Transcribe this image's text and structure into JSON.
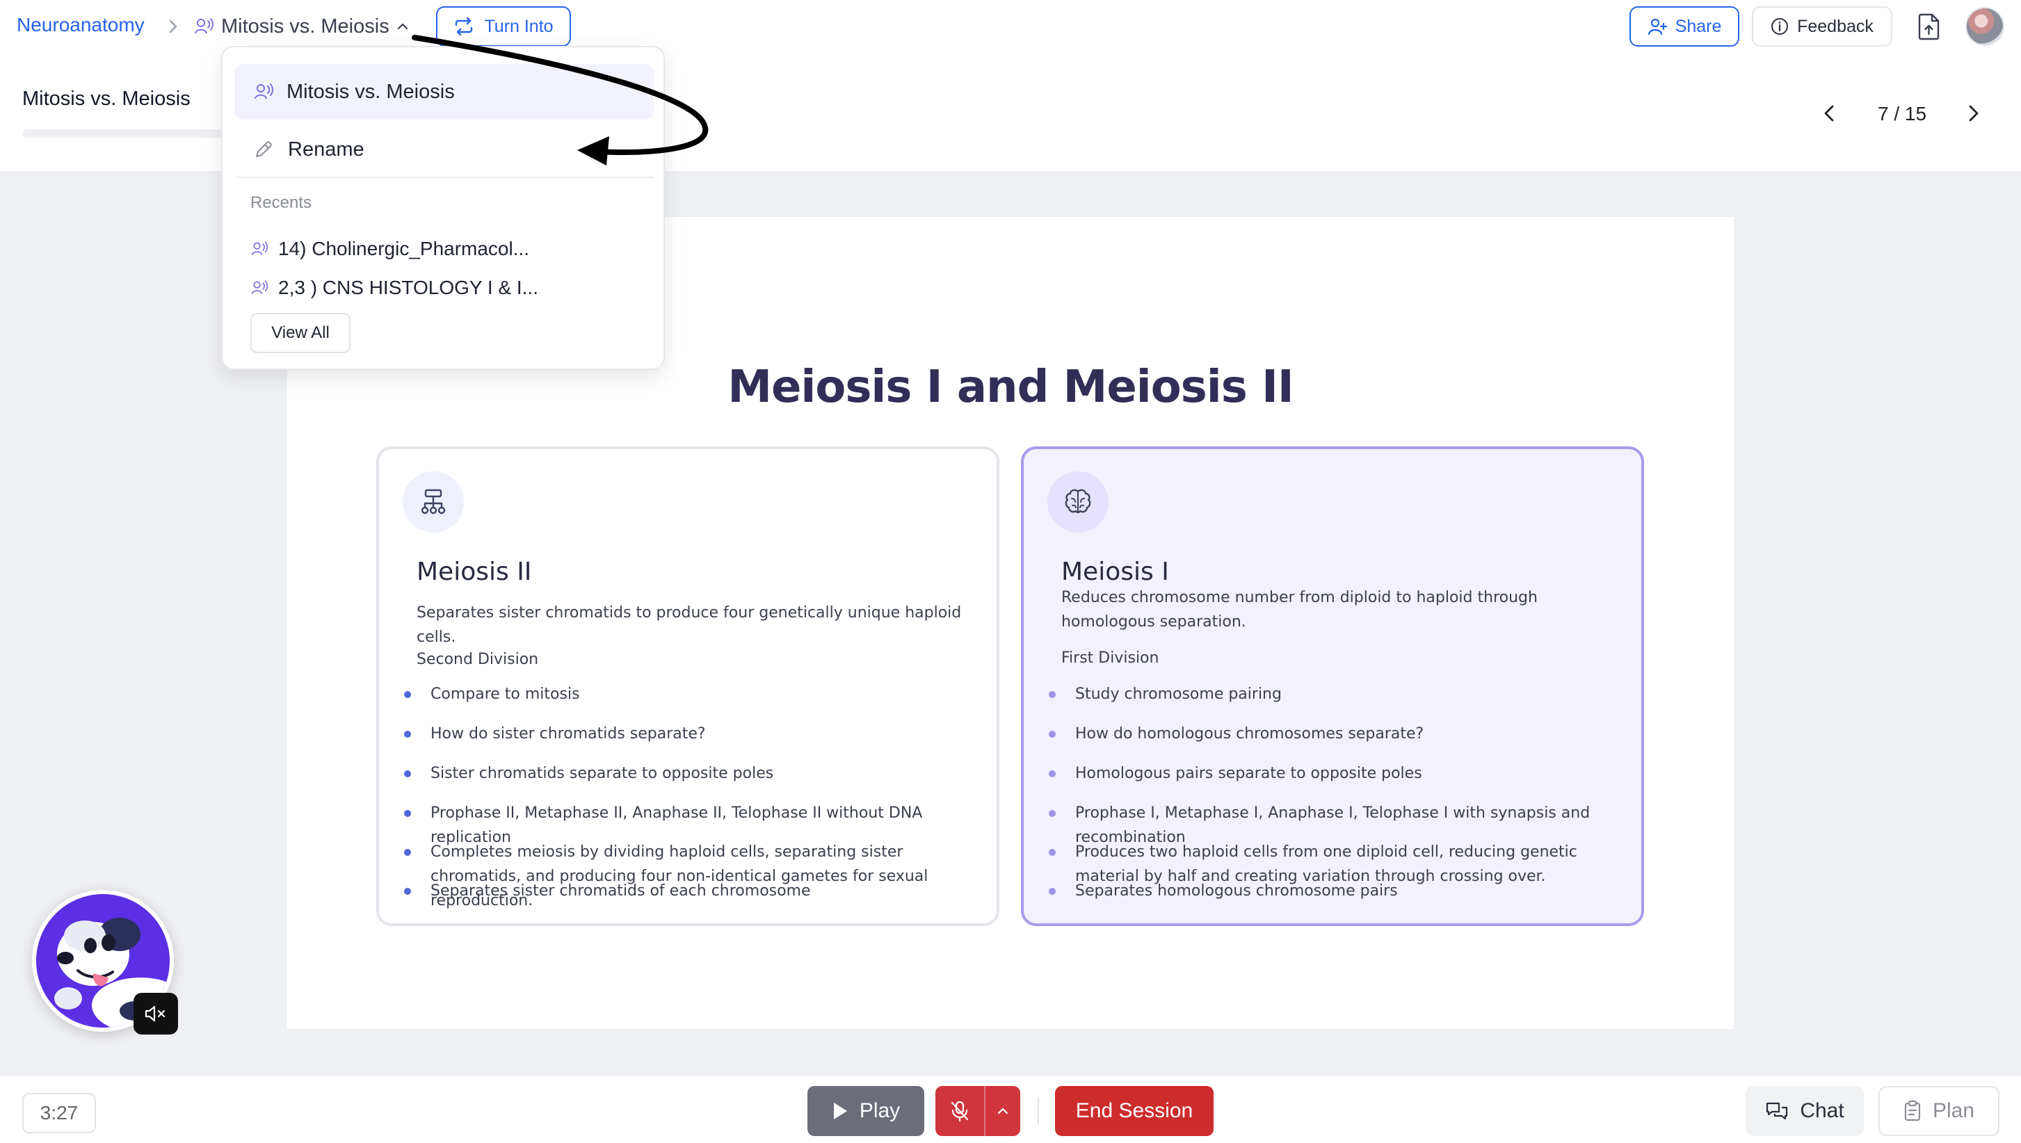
{
  "breadcrumb": {
    "root": "Neuroanatomy",
    "current": "Mitosis vs. Meiosis"
  },
  "toolbar": {
    "turn_into": "Turn Into",
    "share": "Share",
    "feedback": "Feedback"
  },
  "lesson": {
    "title": "Mitosis vs. Meiosis",
    "page": "7 / 15"
  },
  "dropdown": {
    "current": "Mitosis vs. Meiosis",
    "rename": "Rename",
    "recents_label": "Recents",
    "recents": [
      "14) Cholinergic_Pharmacol...",
      "2,3 ) CNS HISTOLOGY I & I..."
    ],
    "view_all": "View All"
  },
  "slide": {
    "title": "Meiosis I and Meiosis II",
    "cards": [
      {
        "title": "Meiosis II",
        "description": "Separates sister chromatids to produce four genetically unique haploid cells.",
        "subtitle": "Second Division",
        "bullets": [
          "Compare to mitosis",
          "How do sister chromatids separate?",
          "Sister chromatids separate to opposite poles",
          "Prophase II, Metaphase II, Anaphase II, Telophase II without DNA replication",
          "Completes meiosis by dividing haploid cells, separating sister chromatids, and producing four non-identical gametes for sexual reproduction.",
          "Separates sister chromatids of each chromosome"
        ]
      },
      {
        "title": "Meiosis I",
        "description": "Reduces chromosome number from diploid to haploid through homologous separation.",
        "subtitle": "First Division",
        "bullets": [
          "Study chromosome pairing",
          "How do homologous chromosomes separate?",
          "Homologous pairs separate to opposite poles",
          "Prophase I, Metaphase I, Anaphase I, Telophase I with synapsis and recombination",
          "Produces two haploid cells from one diploid cell, reducing genetic material by half and creating variation through crossing over.",
          "Separates homologous chromosome pairs"
        ]
      }
    ]
  },
  "bottombar": {
    "timer": "3:27",
    "play": "Play",
    "end_session": "End Session",
    "chat": "Chat",
    "plan": "Plan"
  },
  "colors": {
    "brand_blue": "#2563eb",
    "slide_title": "#312e57",
    "end_session_red": "#cd2c2c",
    "mic_red": "#d0353b",
    "accent_purple": "#a89bec"
  },
  "icons": [
    "chevron-right-icon",
    "podcast-icon",
    "chevron-up-icon",
    "repeat-icon",
    "user-plus-icon",
    "info-icon",
    "file-upload-icon",
    "chevron-left-icon",
    "pencil-icon",
    "hierarchy-icon",
    "brain-icon",
    "speaker-muted-icon",
    "play-icon",
    "mic-off-icon",
    "chat-icon",
    "clipboard-icon"
  ]
}
